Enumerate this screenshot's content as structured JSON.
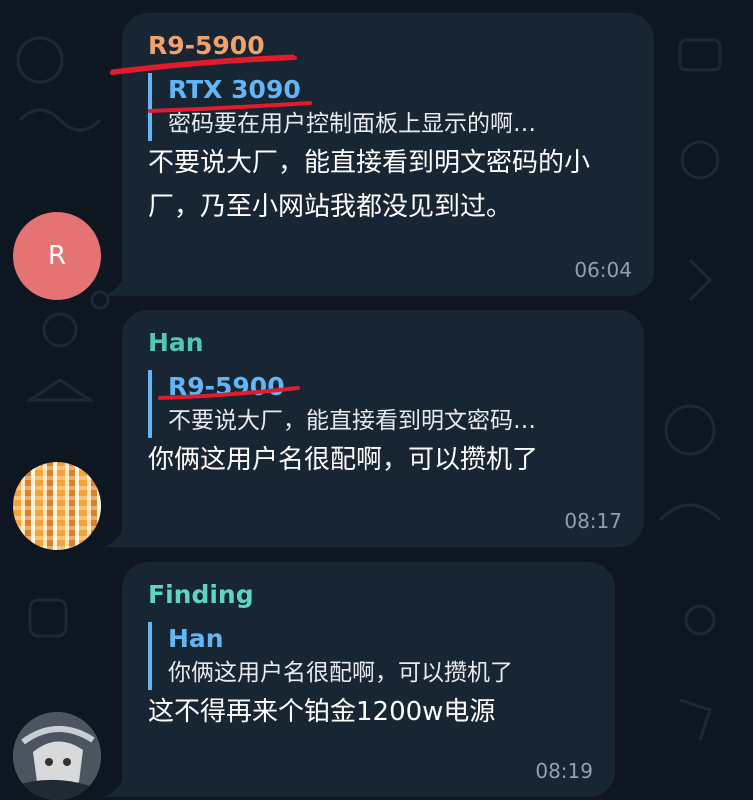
{
  "colors": {
    "background": "#0e1621",
    "bubble": "#182533",
    "sender_r9": "#f0a26b",
    "sender_han": "#52c7b8",
    "sender_finding": "#5fd4c2",
    "reply_accent": "#64b5f6",
    "annotation": "#e21b2d"
  },
  "messages": [
    {
      "sender": "R9-5900",
      "avatar_letter": "R",
      "reply_to": "RTX 3090",
      "reply_text": "密码要在用户控制面板上显示的啊…",
      "text": "不要说大厂，能直接看到明文密码的小厂，乃至小网站我都没见到过。",
      "time": "06:04"
    },
    {
      "sender": "Han",
      "reply_to": "R9-5900",
      "reply_text": "不要说大厂，能直接看到明文密码…",
      "text": "你俩这用户名很配啊，可以攒机了",
      "time": "08:17"
    },
    {
      "sender": "Finding",
      "reply_to": "Han",
      "reply_text": "你俩这用户名很配啊，可以攒机了",
      "text": "这不得再来个铂金1200w电源",
      "time": "08:19"
    }
  ]
}
